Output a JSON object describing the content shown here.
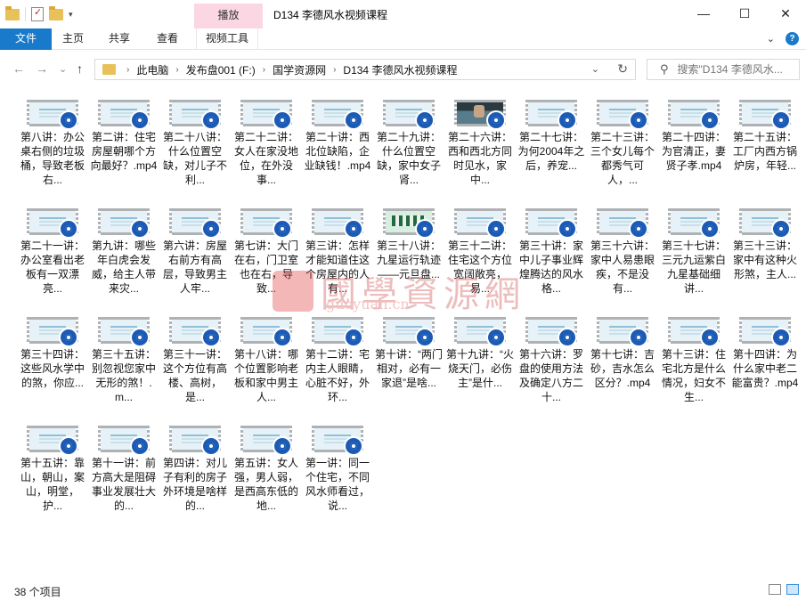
{
  "window": {
    "title": "D134 李德风水视频课程",
    "context_tab": "播放",
    "controls": {
      "minimize": "—",
      "maximize": "☐",
      "close": "✕"
    }
  },
  "ribbon": {
    "file": "文件",
    "home": "主页",
    "share": "共享",
    "view": "查看",
    "video_tools": "视频工具",
    "expand": "⌄",
    "help": "?"
  },
  "nav": {
    "back": "←",
    "forward": "→",
    "recent": "⌄",
    "up": "↑",
    "breadcrumb": [
      "此电脑",
      "发布盘001 (F:)",
      "国学资源网",
      "D134 李德风水视频课程"
    ],
    "refresh": "↻",
    "dropdown": "⌄"
  },
  "search": {
    "placeholder": "搜索\"D134 李德风水...",
    "icon": "⚲"
  },
  "files": [
    {
      "label": "第八讲：办公桌右侧的垃圾桶，导致老板右...",
      "thumb": "plain"
    },
    {
      "label": "第二讲：住宅房屋朝哪个方向最好？.mp4",
      "thumb": "plain"
    },
    {
      "label": "第二十八讲：什么位置空缺，对儿子不利...",
      "thumb": "plain"
    },
    {
      "label": "第二十二讲：女人在家没地位，在外没事...",
      "thumb": "plain"
    },
    {
      "label": "第二十讲：西北位缺陷，企业缺钱！.mp4",
      "thumb": "plain"
    },
    {
      "label": "第二十九讲：什么位置空缺，家中女子肾...",
      "thumb": "plain"
    },
    {
      "label": "第二十六讲：西和西北方同时见水，家中...",
      "thumb": "photo"
    },
    {
      "label": "第二十七讲：为何2004年之后，养宠...",
      "thumb": "plain"
    },
    {
      "label": "第二十三讲：三个女儿每个都秀气可人，...",
      "thumb": "plain"
    },
    {
      "label": "第二十四讲：为官清正，妻贤子孝.mp4",
      "thumb": "plain"
    },
    {
      "label": "第二十五讲：工厂内西方锅炉房，年轻...",
      "thumb": "plain"
    },
    {
      "label": "第二十一讲：办公室看出老板有一双漂亮...",
      "thumb": "plain"
    },
    {
      "label": "第九讲：哪些年白虎会发威，给主人带来灾...",
      "thumb": "plain"
    },
    {
      "label": "第六讲：房屋右前方有高层，导致男主人牢...",
      "thumb": "plain"
    },
    {
      "label": "第七讲：大门在右，门卫室也在右，导致...",
      "thumb": "plain"
    },
    {
      "label": "第三讲：怎样才能知道住这个房屋内的人有...",
      "thumb": "plain"
    },
    {
      "label": "第三十八讲：九星运行轨迹——元旦盘...",
      "thumb": "board"
    },
    {
      "label": "第三十二讲：住宅这个方位宽阔敞亮，易...",
      "thumb": "plain"
    },
    {
      "label": "第三十讲：家中儿子事业辉煌腾达的风水格...",
      "thumb": "plain"
    },
    {
      "label": "第三十六讲：家中人易患眼疾，不是没有...",
      "thumb": "plain"
    },
    {
      "label": "第三十七讲：三元九运紫白九星基础细讲...",
      "thumb": "plain"
    },
    {
      "label": "第三十三讲：家中有这种火形煞，主人...",
      "thumb": "plain"
    },
    {
      "label": "第三十四讲：这些风水学中的煞，你应...",
      "thumb": "plain"
    },
    {
      "label": "第三十五讲：别忽视您家中无形的煞！.m...",
      "thumb": "plain"
    },
    {
      "label": "第三十一讲：这个方位有高楼、高树，是...",
      "thumb": "plain"
    },
    {
      "label": "第十八讲：哪个位置影响老板和家中男主人...",
      "thumb": "plain"
    },
    {
      "label": "第十二讲：宅内主人眼睛，心脏不好，外环...",
      "thumb": "plain"
    },
    {
      "label": "第十讲：“两门相对，必有一家退”是啥...",
      "thumb": "plain"
    },
    {
      "label": "第十九讲：“火烧天门，必伤主”是什...",
      "thumb": "plain"
    },
    {
      "label": "第十六讲：罗盘的使用方法及确定八方二十...",
      "thumb": "plain"
    },
    {
      "label": "第十七讲：吉砂，吉水怎么区分？.mp4",
      "thumb": "plain"
    },
    {
      "label": "第十三讲：住宅北方是什么情况，妇女不生...",
      "thumb": "plain"
    },
    {
      "label": "第十四讲：为什么家中老二能富贵？.mp4",
      "thumb": "plain"
    },
    {
      "label": "第十五讲：靠山，朝山，案山，明堂，护...",
      "thumb": "plain"
    },
    {
      "label": "第十一讲：前方高大是阻碍事业发展壮大的...",
      "thumb": "plain"
    },
    {
      "label": "第四讲：对儿子有利的房子外环境是啥样的...",
      "thumb": "plain"
    },
    {
      "label": "第五讲：女人强，男人弱，是西高东低的地...",
      "thumb": "plain"
    },
    {
      "label": "第一讲：同一个住宅，不同风水师看过，说...",
      "thumb": "plain"
    }
  ],
  "watermark": {
    "chinese": "國學資源網",
    "url": "guoyuan.cn"
  },
  "status": {
    "count": "38 个项目"
  },
  "colors": {
    "accent": "#1979ca",
    "context_tab": "#fbd6e3",
    "badge": "#1c5bb5"
  }
}
